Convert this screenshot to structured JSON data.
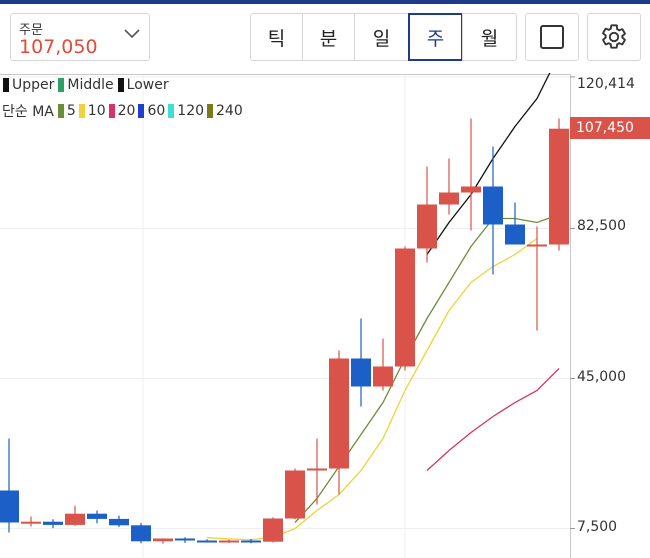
{
  "header": {
    "order_label": "주문",
    "order_price": "107,050",
    "periods": [
      "틱",
      "분",
      "일",
      "주",
      "월"
    ],
    "active_period": "주"
  },
  "legend": {
    "bands": [
      {
        "label": "Upper",
        "color": "#111111"
      },
      {
        "label": "Middle",
        "color": "#2e9e6b"
      },
      {
        "label": "Lower",
        "color": "#111111"
      }
    ],
    "ma_title": "단순 MA",
    "ma": [
      {
        "label": "5",
        "color": "#6b8e3a"
      },
      {
        "label": "10",
        "color": "#f2d13a"
      },
      {
        "label": "20",
        "color": "#d6336c"
      },
      {
        "label": "60",
        "color": "#1f3fd1"
      },
      {
        "label": "120",
        "color": "#3ee0d0"
      },
      {
        "label": "240",
        "color": "#7a7a1a"
      }
    ]
  },
  "axis": {
    "ticks": [
      "120,414",
      "82,500",
      "45,000",
      "7,500"
    ],
    "current_price": "107,450"
  },
  "colors": {
    "up": "#d9534a",
    "down": "#1c5fc7",
    "accent": "#1e3a8a"
  },
  "chart_data": {
    "type": "candlestick",
    "price_ticks": [
      120414,
      82500,
      45000,
      7500
    ],
    "current_price": 107450,
    "candles": [
      {
        "o": 17000,
        "h": 30000,
        "l": 6500,
        "c": 9000
      },
      {
        "o": 9000,
        "h": 10500,
        "l": 8000,
        "c": 9200
      },
      {
        "o": 9200,
        "h": 9800,
        "l": 7600,
        "c": 8400
      },
      {
        "o": 8400,
        "h": 13200,
        "l": 8200,
        "c": 11200
      },
      {
        "o": 11200,
        "h": 12000,
        "l": 8800,
        "c": 9900
      },
      {
        "o": 9900,
        "h": 10700,
        "l": 7900,
        "c": 8300
      },
      {
        "o": 8300,
        "h": 8900,
        "l": 3800,
        "c": 4300
      },
      {
        "o": 4300,
        "h": 4800,
        "l": 3700,
        "c": 5000
      },
      {
        "o": 5000,
        "h": 5300,
        "l": 3900,
        "c": 4500
      },
      {
        "o": 4500,
        "h": 4800,
        "l": 4000,
        "c": 4300
      },
      {
        "o": 4300,
        "h": 4700,
        "l": 3900,
        "c": 4500
      },
      {
        "o": 4500,
        "h": 4900,
        "l": 3800,
        "c": 4200
      },
      {
        "o": 4200,
        "h": 10300,
        "l": 4000,
        "c": 10000
      },
      {
        "o": 10000,
        "h": 22500,
        "l": 9800,
        "c": 22000
      },
      {
        "o": 22000,
        "h": 30000,
        "l": 13500,
        "c": 22500
      },
      {
        "o": 22500,
        "h": 52000,
        "l": 16000,
        "c": 50000
      },
      {
        "o": 50000,
        "h": 60000,
        "l": 38000,
        "c": 43000
      },
      {
        "o": 43000,
        "h": 55000,
        "l": 42000,
        "c": 48000
      },
      {
        "o": 48000,
        "h": 78000,
        "l": 47000,
        "c": 77500
      },
      {
        "o": 77500,
        "h": 98000,
        "l": 74000,
        "c": 88500
      },
      {
        "o": 88500,
        "h": 100000,
        "l": 86000,
        "c": 91500
      },
      {
        "o": 91500,
        "h": 110000,
        "l": 82000,
        "c": 93000
      },
      {
        "o": 93000,
        "h": 103000,
        "l": 71000,
        "c": 83500
      },
      {
        "o": 83500,
        "h": 89000,
        "l": 78500,
        "c": 78500
      },
      {
        "o": 78500,
        "h": 83000,
        "l": 57000,
        "c": 78500
      },
      {
        "o": 78500,
        "h": 110000,
        "l": 77000,
        "c": 107450
      }
    ],
    "ma5": [
      [
        13,
        9000
      ],
      [
        14,
        15000
      ],
      [
        15,
        23000
      ],
      [
        16,
        31000
      ],
      [
        17,
        39000
      ],
      [
        18,
        50000
      ],
      [
        19,
        60000
      ],
      [
        20,
        69000
      ],
      [
        21,
        78000
      ],
      [
        22,
        85000
      ],
      [
        23,
        85000
      ],
      [
        24,
        84000
      ],
      [
        25,
        86000
      ]
    ],
    "ma10": [
      [
        9,
        5200
      ],
      [
        10,
        4900
      ],
      [
        11,
        4700
      ],
      [
        12,
        5300
      ],
      [
        13,
        7500
      ],
      [
        14,
        12000
      ],
      [
        15,
        16000
      ],
      [
        16,
        22000
      ],
      [
        17,
        30000
      ],
      [
        18,
        42000
      ],
      [
        19,
        52000
      ],
      [
        20,
        62000
      ],
      [
        21,
        69000
      ],
      [
        22,
        73000
      ],
      [
        23,
        76000
      ],
      [
        24,
        80000
      ]
    ],
    "ma20": [
      [
        19,
        22000
      ],
      [
        20,
        27000
      ],
      [
        21,
        31500
      ],
      [
        22,
        35500
      ],
      [
        23,
        39000
      ],
      [
        24,
        42000
      ],
      [
        25,
        47500
      ]
    ],
    "upper": [
      [
        19,
        76000
      ],
      [
        20,
        84000
      ],
      [
        21,
        91000
      ],
      [
        22,
        100000
      ],
      [
        23,
        108000
      ],
      [
        24,
        115000
      ],
      [
        25,
        126000
      ]
    ]
  }
}
